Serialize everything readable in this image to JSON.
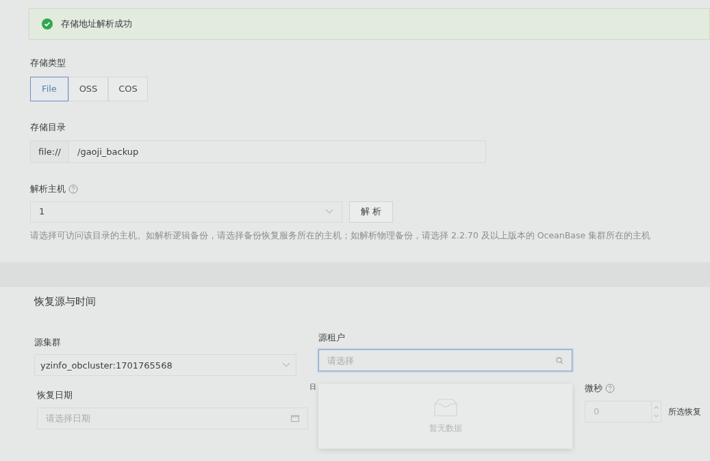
{
  "alert": {
    "text": "存储地址解析成功"
  },
  "storage_type": {
    "label": "存储类型",
    "options": [
      {
        "label": "File",
        "selected": true
      },
      {
        "label": "OSS",
        "selected": false
      },
      {
        "label": "COS",
        "selected": false
      }
    ]
  },
  "storage_dir": {
    "label": "存储目录",
    "prefix": "file://",
    "value": "/gaoji_backup"
  },
  "parse_host": {
    "label": "解析主机",
    "value": "1",
    "button": "解 析",
    "help": "请选择可访问该目录的主机。如解析逻辑备份，请选择备份恢复服务所在的主机；如解析物理备份，请选择 2.2.70 及以上版本的 OceanBase 集群所在的主机"
  },
  "section_title": "恢复源与时间",
  "source_cluster": {
    "label": "源集群",
    "value": "yzinfo_obcluster:1701765568"
  },
  "source_tenant": {
    "label": "源租户",
    "placeholder": "请选择",
    "focused": true,
    "dropdown": {
      "empty_text": "暂无数据"
    }
  },
  "restore_date": {
    "label": "恢复日期",
    "placeholder": "请选择日期"
  },
  "field_3": {
    "label": "日"
  },
  "microsecond": {
    "label": "微秒",
    "placeholder": "0"
  },
  "trailing_text": "所选恢复"
}
